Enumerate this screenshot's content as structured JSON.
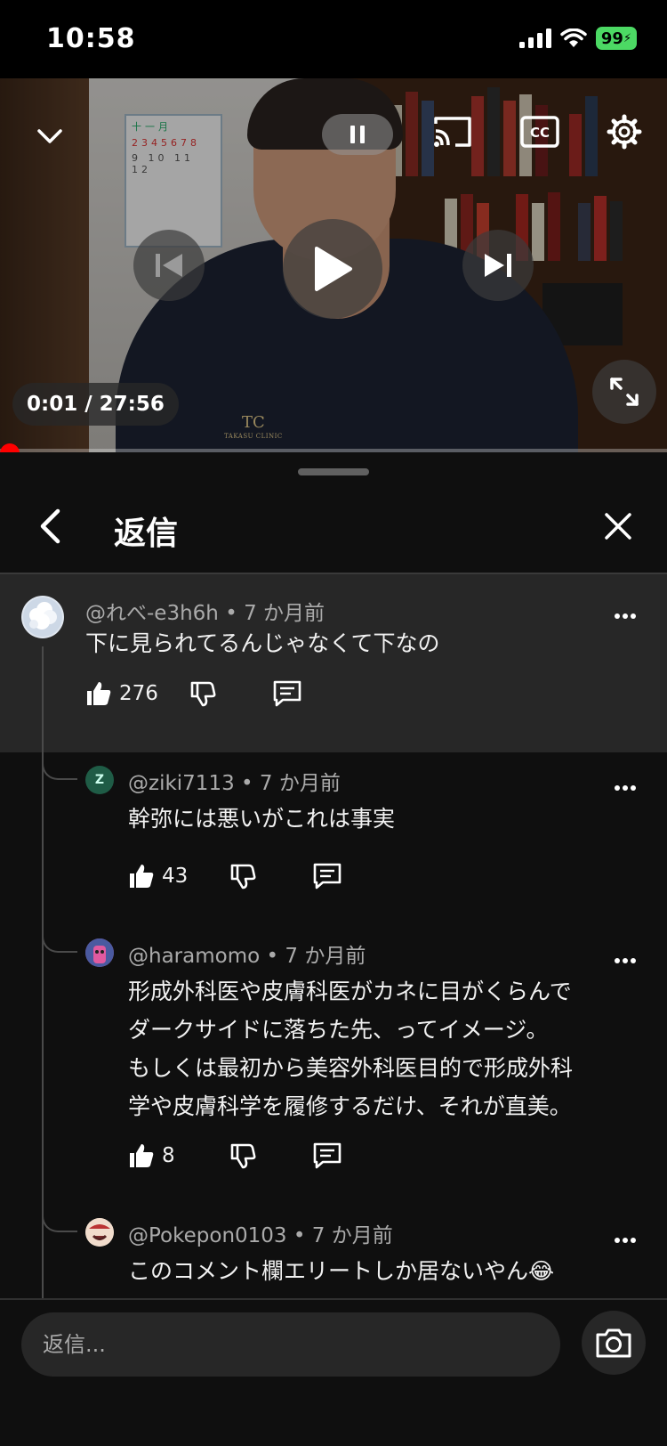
{
  "status_bar": {
    "time": "10:58",
    "battery": "99"
  },
  "player": {
    "timestamp": "0:01 / 27:56",
    "progress": 0.0006,
    "clinic_logo": "TC",
    "clinic_name": "TAKASU CLINIC",
    "icons": [
      "chevron-down-icon",
      "pause-icon",
      "cast-icon",
      "captions-icon",
      "settings-icon",
      "previous-icon",
      "play-icon",
      "next-icon",
      "fullscreen-icon"
    ]
  },
  "sheet": {
    "title": "返信"
  },
  "parent_comment": {
    "author": "@れべ-e3h6h",
    "time": "7 か月前",
    "text": "下に見られてるんじゃなくて下なの",
    "likes": "276"
  },
  "replies": [
    {
      "author": "@ziki7113",
      "avatar_letter": "Z",
      "avatar_color": "#1f5c46",
      "time": "7 か月前",
      "lines": [
        "幹弥には悪いがこれは事実"
      ],
      "likes": "43"
    },
    {
      "author": "@haramomo",
      "avatar_color": "#b84a86",
      "time": "7 か月前",
      "lines": [
        "形成外科医や皮膚科医がカネに目がくらんで",
        "ダークサイドに落ちた先、ってイメージ。",
        "もしくは最初から美容外科医目的で形成外科",
        "学や皮膚科学を履修するだけ、それが直美。"
      ],
      "likes": "8"
    },
    {
      "author": "@Pokepon0103",
      "avatar_color": "#e9d6c6",
      "time": "7 か月前",
      "lines": [
        "このコメント欄エリートしか居ないやん😂"
      ]
    }
  ],
  "reply_box": {
    "placeholder": "返信..."
  },
  "separator": "•"
}
